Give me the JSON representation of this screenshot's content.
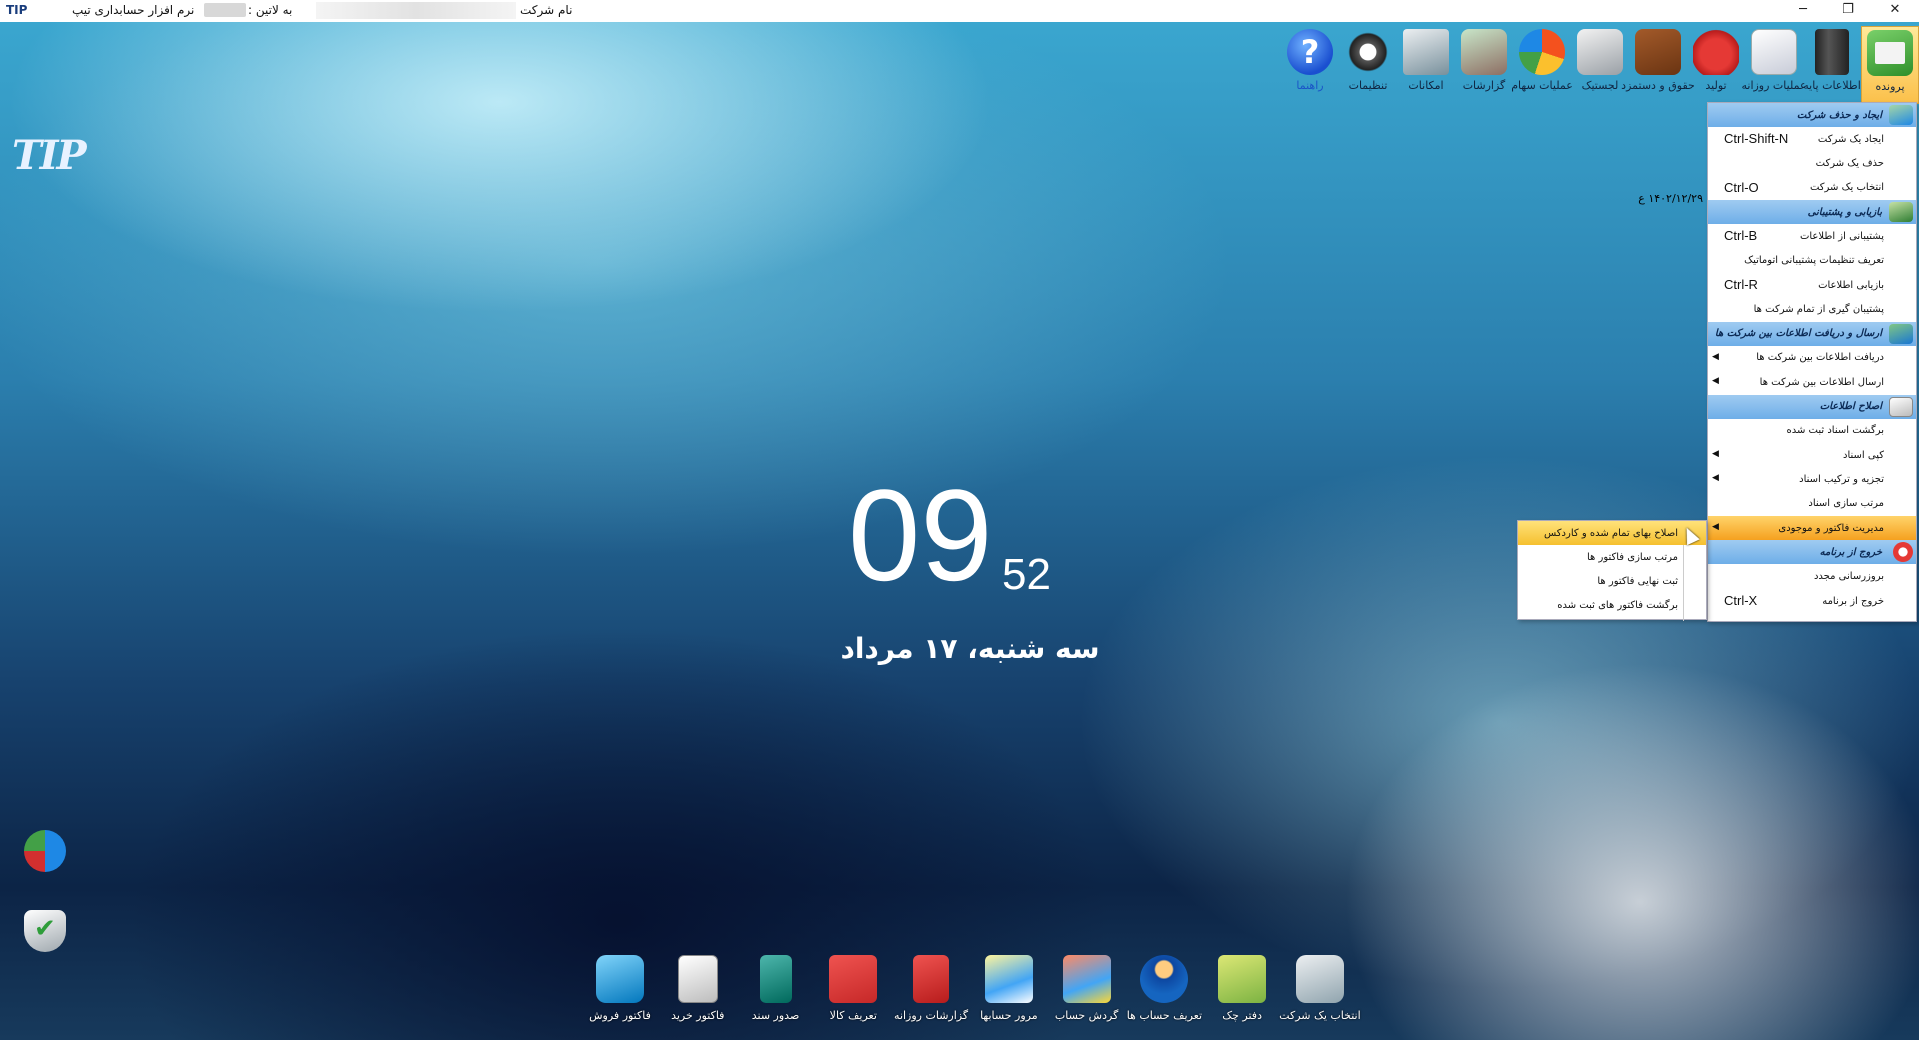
{
  "titlebar": {
    "logo_text": "TIP",
    "app_title": "نرم افزار حسابداری تیپ",
    "latin_label": "به لاتین :",
    "company_label": "نام شرکت",
    "minimize": "─",
    "maximize": "❐",
    "close": "✕"
  },
  "toolbar": {
    "items": [
      {
        "label": "پرونده",
        "icon": "file-folder-icon"
      },
      {
        "label": "اطلاعات پایه",
        "icon": "base-info-icon"
      },
      {
        "label": "عملیات روزانه",
        "icon": "daily-ops-icon"
      },
      {
        "label": "تولید",
        "icon": "production-icon"
      },
      {
        "label": "حقوق و دستمزد",
        "icon": "wallet-icon"
      },
      {
        "label": "لجستیک",
        "icon": "truck-icon"
      },
      {
        "label": "عملیات سهام",
        "icon": "pie-chart-icon"
      },
      {
        "label": "گزارشات",
        "icon": "report-icon"
      },
      {
        "label": "امکانات",
        "icon": "tools-icon"
      },
      {
        "label": "تنظیمات",
        "icon": "gear-icon"
      },
      {
        "label": "راهنما",
        "icon": "help-icon",
        "glyph": "?"
      }
    ]
  },
  "clock": {
    "hours": "09",
    "minutes": "52",
    "date": "سه شنبه، ۱۷ مرداد"
  },
  "date_text": "۱۴۰۲/۱۲/۲۹ ع",
  "main_menu": {
    "sections": [
      {
        "header": "ایجاد و حذف شرکت",
        "items": [
          {
            "label": "ایجاد یک شرکت",
            "shortcut": "Ctrl-Shift-N"
          },
          {
            "label": "حذف یک شرکت",
            "shortcut": ""
          },
          {
            "label": "انتخاب یک شرکت",
            "shortcut": "Ctrl-O"
          }
        ]
      },
      {
        "header": "بازیابی و پشتیبانی",
        "items": [
          {
            "label": "پشتیبانی از اطلاعات",
            "shortcut": "Ctrl-B"
          },
          {
            "label": "تعریف تنظیمات پشتیبانی اتوماتیک",
            "shortcut": ""
          },
          {
            "label": "بازیابی اطلاعات",
            "shortcut": "Ctrl-R"
          },
          {
            "label": "پشتیبان گیری از تمام شرکت ها",
            "shortcut": ""
          }
        ]
      },
      {
        "header": "ارسال و دریافت اطلاعات بین شرکت ها",
        "items": [
          {
            "label": "دریافت اطلاعات بین شرکت ها",
            "arrow": "◀"
          },
          {
            "label": "ارسال اطلاعات بین شرکت ها",
            "arrow": "◀"
          }
        ]
      },
      {
        "header": "اصلاح اطلاعات",
        "items": [
          {
            "label": "برگشت اسناد ثبت شده",
            "arrow": ""
          },
          {
            "label": "کپی اسناد",
            "arrow": "◀"
          },
          {
            "label": "تجزیه و ترکیب اسناد",
            "arrow": "◀"
          },
          {
            "label": "مرتب سازی اسناد",
            "arrow": ""
          },
          {
            "label": "مدیریت فاکتور و موجودی",
            "arrow": "◀",
            "highlight": true
          }
        ]
      },
      {
        "header": "خروج از برنامه",
        "items": [
          {
            "label": "بروزرسانی مجدد",
            "shortcut": ""
          },
          {
            "label": "خروج از برنامه",
            "shortcut": "Ctrl-X"
          }
        ]
      }
    ]
  },
  "sub_menu": {
    "items": [
      {
        "label": "اصلاح بهای تمام شده و کاردکس",
        "highlight": true
      },
      {
        "label": "مرتب سازی فاکتور ها"
      },
      {
        "label": "ثبت نهایی فاکتور ها"
      },
      {
        "label": "برگشت فاکتور های ثبت شده"
      }
    ]
  },
  "quickbar": {
    "items": [
      {
        "label": "انتخاب یک شرکت",
        "icon": "database-icon"
      },
      {
        "label": "دفتر چک",
        "icon": "money-icon"
      },
      {
        "label": "تعریف حساب ها",
        "icon": "user-icon"
      },
      {
        "label": "گردش حساب",
        "icon": "chart-icon"
      },
      {
        "label": "مرور حسابها",
        "icon": "magnifier-icon"
      },
      {
        "label": "گزارشات روزانه",
        "icon": "books-icon"
      },
      {
        "label": "تعریف کالا",
        "icon": "boxes-icon"
      },
      {
        "label": "صدور سند",
        "icon": "binder-icon"
      },
      {
        "label": "فاکتور خرید",
        "icon": "invoice-icon"
      },
      {
        "label": "فاکتور فروش",
        "icon": "register-icon"
      }
    ]
  }
}
